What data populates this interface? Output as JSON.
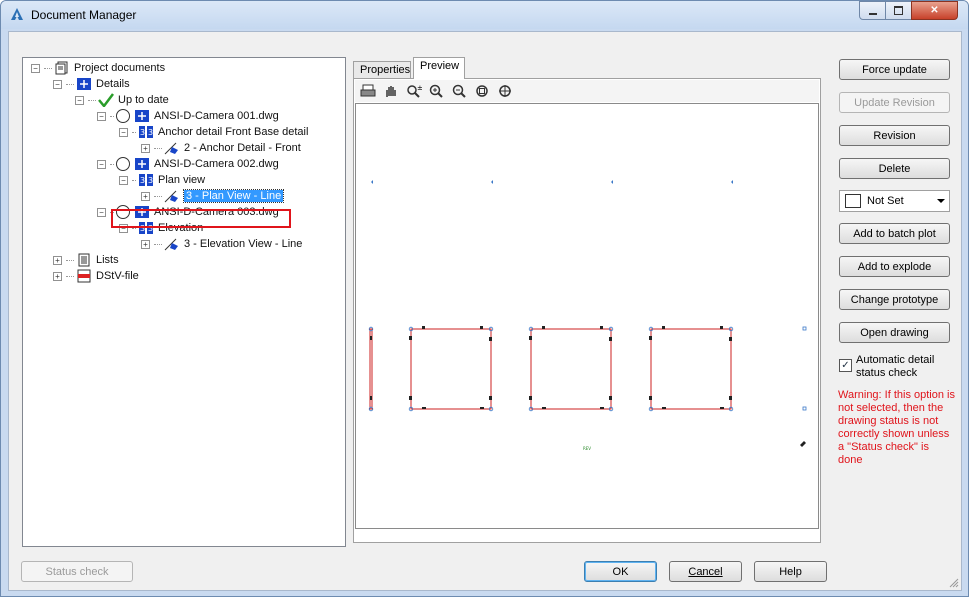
{
  "window": {
    "title": "Document Manager"
  },
  "tree": {
    "nodes": [
      {
        "label": "Project documents",
        "icon": "project-docs-icon"
      },
      {
        "label": "Details",
        "icon": "details-icon"
      },
      {
        "label": "Up to date",
        "icon": "checkmark-icon"
      },
      {
        "label": "ANSI-D-Camera 001.dwg",
        "icon": "drawing-icon"
      },
      {
        "label": "Anchor detail Front Base detail",
        "icon": "sheet-icon"
      },
      {
        "label": "2 - Anchor Detail - Front",
        "icon": "view-icon"
      },
      {
        "label": "ANSI-D-Camera 002.dwg",
        "icon": "drawing-icon"
      },
      {
        "label": "Plan view",
        "icon": "sheet-icon"
      },
      {
        "label": "3 - Plan View - Line",
        "icon": "view-icon"
      },
      {
        "label": "ANSI-D-Camera 003.dwg",
        "icon": "drawing-icon"
      },
      {
        "label": "Elevation",
        "icon": "sheet-icon"
      },
      {
        "label": "3 - Elevation View - Line",
        "icon": "view-icon"
      },
      {
        "label": "Lists",
        "icon": "lists-icon"
      },
      {
        "label": "DStV-file",
        "icon": "dstv-file-icon"
      }
    ]
  },
  "tabs": [
    {
      "label": "Properties"
    },
    {
      "label": "Preview"
    }
  ],
  "preview": {
    "marker_text": "REV"
  },
  "buttons": {
    "force_update": "Force update",
    "update_revision": "Update Revision",
    "revision": "Revision",
    "delete": "Delete",
    "add_batch_plot": "Add to batch plot",
    "add_explode": "Add to explode",
    "change_prototype": "Change prototype",
    "open_drawing": "Open drawing"
  },
  "status_combo": {
    "value": "Not Set"
  },
  "auto_check": {
    "label": "Automatic detail status check",
    "checked": true
  },
  "warning": "Warning: If this option is not selected, then the drawing status is not correctly shown unless a \"Status check\" is done",
  "footer": {
    "status_check": "Status check",
    "ok": "OK",
    "cancel": "Cancel",
    "help": "Help"
  },
  "colors": {
    "warning": "#e0141b",
    "selection": "#3399ff",
    "frame": "#cc2222"
  }
}
